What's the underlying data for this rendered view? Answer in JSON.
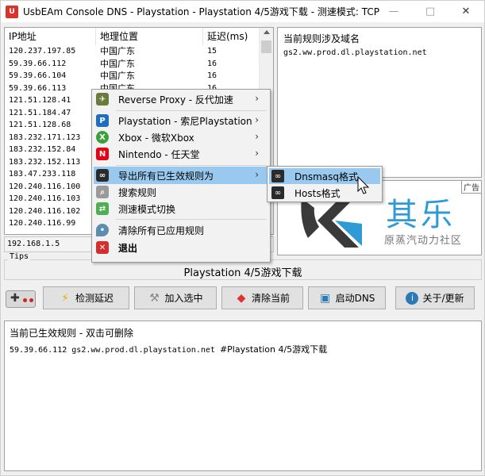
{
  "window": {
    "title": "UsbEAm Console DNS - Playstation - Playstation 4/5游戏下载 - 测速模式: TCP",
    "icon_text": "U",
    "minimize": "—",
    "maximize": "□",
    "close": "✕"
  },
  "ip_list": {
    "headers": [
      "IP地址",
      "地理位置",
      "延迟(ms)"
    ],
    "rows": [
      {
        "ip": "120.237.197.85",
        "geo": "中国广东",
        "delay": "15"
      },
      {
        "ip": "59.39.66.112",
        "geo": "中国广东",
        "delay": "16"
      },
      {
        "ip": "59.39.66.104",
        "geo": "中国广东",
        "delay": "16"
      },
      {
        "ip": "59.39.66.113",
        "geo": "中国广东",
        "delay": "16"
      },
      {
        "ip": "121.51.128.41",
        "geo": "",
        "delay": ""
      },
      {
        "ip": "121.51.184.47",
        "geo": "",
        "delay": ""
      },
      {
        "ip": "121.51.128.68",
        "geo": "",
        "delay": ""
      },
      {
        "ip": "183.232.171.123",
        "geo": "",
        "delay": ""
      },
      {
        "ip": "183.232.152.84",
        "geo": "",
        "delay": ""
      },
      {
        "ip": "183.232.152.113",
        "geo": "",
        "delay": ""
      },
      {
        "ip": "183.47.233.118",
        "geo": "",
        "delay": ""
      },
      {
        "ip": "120.240.116.100",
        "geo": "",
        "delay": ""
      },
      {
        "ip": "120.240.116.103",
        "geo": "",
        "delay": ""
      },
      {
        "ip": "120.240.116.102",
        "geo": "",
        "delay": ""
      },
      {
        "ip": "120.240.116.99",
        "geo": "",
        "delay": ""
      }
    ]
  },
  "domain_panel": {
    "title": "当前规则涉及域名",
    "items": [
      "gs2.ww.prod.dl.playstation.net"
    ]
  },
  "ad": {
    "tag": "广告",
    "big_text": "其乐",
    "sub_text": "原蒸汽动力社区"
  },
  "ip_field": "192.168.1.5",
  "tips": {
    "legend": "Tips",
    "text": "Playstation 4/5游戏下载"
  },
  "toolbar": {
    "check_delay": "检测延迟",
    "add_selected": "加入选中",
    "clear_current": "清除当前",
    "start_dns": "启动DNS",
    "about_update": "关于/更新"
  },
  "rules_panel": {
    "title": "当前已生效规则 - 双击可删除",
    "rule_ip": "59.39.66.112",
    "rule_domain": "gs2.ww.prod.dl.playstation.net",
    "rule_comment": "#Playstation 4/5游戏下载"
  },
  "context_menu": {
    "items": [
      {
        "label": "Reverse Proxy - 反代加速",
        "arrow": "›",
        "icon": "rocket-icon",
        "color": "#6a7b3a"
      },
      {
        "label": "Playstation - 索尼Playstation",
        "arrow": "›",
        "icon": "playstation-icon",
        "color": "#1f6fbf"
      },
      {
        "label": "Xbox - 微软Xbox",
        "arrow": "›",
        "icon": "xbox-icon",
        "color": "#3aa13a"
      },
      {
        "label": "Nintendo - 任天堂",
        "arrow": "›",
        "icon": "nintendo-icon",
        "color": "#e60012"
      },
      {
        "label": "导出所有已生效规则为",
        "arrow": "›",
        "icon": "export-icon",
        "color": "#2b2b2b"
      },
      {
        "label": "搜索规则",
        "arrow": "",
        "icon": "search-icon",
        "color": "#7a7a7a"
      },
      {
        "label": "测速模式切换",
        "arrow": "",
        "icon": "switch-icon",
        "color": "#4caf50"
      },
      {
        "label": "清除所有已应用规则",
        "arrow": "",
        "icon": "drop-icon",
        "color": "#5b8db0"
      },
      {
        "label": "退出",
        "arrow": "",
        "icon": "exit-icon",
        "color": "#d32f2f"
      }
    ]
  },
  "submenu": {
    "items": [
      {
        "label": "Dnsmasq格式"
      },
      {
        "label": "Hosts格式"
      }
    ]
  }
}
